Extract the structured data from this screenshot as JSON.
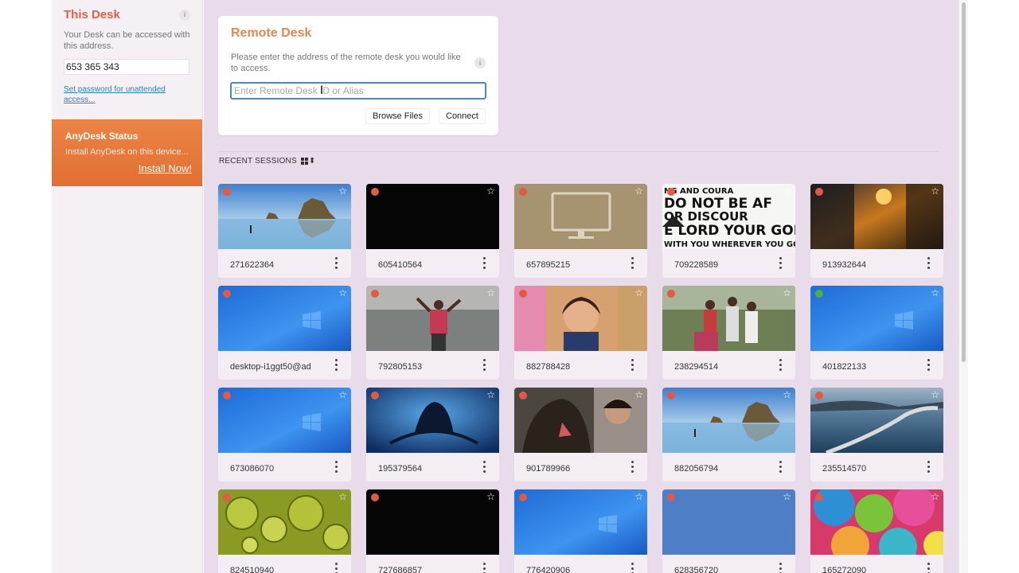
{
  "this_desk": {
    "title": "This Desk",
    "info": "i",
    "description": "Your Desk can be accessed with this address.",
    "address": "653 365 343",
    "password_link": "Set password for unattended access..."
  },
  "status": {
    "title": "AnyDesk Status",
    "description": "Install AnyDesk on this device...",
    "install_label": "Install Now!"
  },
  "remote_desk": {
    "title": "Remote Desk",
    "description": "Please enter the address of the remote desk you would like to access.",
    "info": "i",
    "input_placeholder": "Enter Remote Desk ID or Alias",
    "input_value": "",
    "browse_files_label": "Browse Files",
    "connect_label": "Connect"
  },
  "recent": {
    "label": "RECENT SESSIONS",
    "view_toggle": "⬍"
  },
  "sessions": [
    {
      "id": "271622364",
      "status": "offline",
      "thumb": "beach-rock"
    },
    {
      "id": "605410564",
      "status": "offline",
      "thumb": "black"
    },
    {
      "id": "657895215",
      "status": "offline",
      "thumb": "monitor"
    },
    {
      "id": "709228589",
      "status": "offline",
      "thumb": "text-poster"
    },
    {
      "id": "913932644",
      "status": "offline",
      "thumb": "sunset-street"
    },
    {
      "id": "desktop-i1ggt50@ad",
      "status": "offline",
      "thumb": "windows"
    },
    {
      "id": "792805153",
      "status": "offline",
      "thumb": "sea-person"
    },
    {
      "id": "882788428",
      "status": "offline",
      "thumb": "girl-photo"
    },
    {
      "id": "238294514",
      "status": "offline",
      "thumb": "family-photo"
    },
    {
      "id": "401822133",
      "status": "online",
      "thumb": "windows"
    },
    {
      "id": "673086070",
      "status": "offline",
      "thumb": "windows"
    },
    {
      "id": "195379564",
      "status": "offline",
      "thumb": "shiva-blue"
    },
    {
      "id": "901789966",
      "status": "offline",
      "thumb": "dog-photo"
    },
    {
      "id": "882056794",
      "status": "offline",
      "thumb": "beach-rock"
    },
    {
      "id": "235514570",
      "status": "offline",
      "thumb": "road-sea"
    },
    {
      "id": "824510940",
      "status": "offline",
      "thumb": "green-bubbles"
    },
    {
      "id": "727686857",
      "status": "offline",
      "thumb": "black"
    },
    {
      "id": "776420906",
      "status": "offline",
      "thumb": "windows"
    },
    {
      "id": "628356720",
      "status": "offline",
      "thumb": "plain-blue"
    },
    {
      "id": "165272090",
      "status": "offline",
      "thumb": "umbrellas"
    }
  ],
  "poster_text": [
    "NG AND COURA",
    "DO NOT BE AF",
    "OR DISCOUR",
    "E LORD YOUR GOD",
    "WITH YOU WHEREVER YOU GO"
  ],
  "colors": {
    "accent_orange": "#e4884f",
    "this_desk_red": "#e2604a",
    "status_orange": "#ea8445",
    "offline_dot": "#e05a46",
    "online_dot": "#4cb04a",
    "main_bg": "#e9dcea"
  }
}
